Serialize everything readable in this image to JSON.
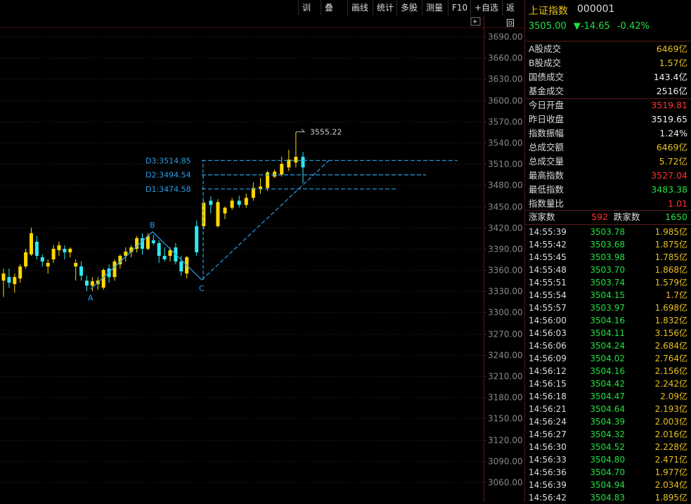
{
  "toolbar": {
    "buttons": [
      "训练",
      "叠加",
      "画线",
      "统计",
      "多股",
      "测量",
      "F10",
      "+自选",
      "返回"
    ]
  },
  "colors": {
    "up": "#ffd700",
    "down": "#30e8f0",
    "accent_cyan": "#2a9fe8",
    "green": "#22e040",
    "red": "#ff3030"
  },
  "quote": {
    "name": "上证指数",
    "code": "000001",
    "price": "3505.00",
    "arrow": "▼",
    "change": "-14.65",
    "change_pct": "-0.42%"
  },
  "stats": [
    {
      "label": "A股成交",
      "value": "6469亿",
      "color": "yellow"
    },
    {
      "label": "B股成交",
      "value": "1.57亿",
      "color": "yellow"
    },
    {
      "label": "国债成交",
      "value": "143.4亿",
      "color": "white"
    },
    {
      "label": "基金成交",
      "value": "2516亿",
      "color": "white"
    },
    {
      "label": "今日开盘",
      "value": "3519.81",
      "color": "red"
    },
    {
      "label": "昨日收盘",
      "value": "3519.65",
      "color": "white"
    },
    {
      "label": "指数振幅",
      "value": "1.24%",
      "color": "white"
    },
    {
      "label": "总成交额",
      "value": "6469亿",
      "color": "yellow"
    },
    {
      "label": "总成交量",
      "value": "5.72亿",
      "color": "yellow"
    },
    {
      "label": "最高指数",
      "value": "3527.04",
      "color": "red"
    },
    {
      "label": "最低指数",
      "value": "3483.38",
      "color": "green"
    },
    {
      "label": "指数量比",
      "value": "1.01",
      "color": "red"
    }
  ],
  "breadth": {
    "up_label": "涨家数",
    "up_value": "592",
    "down_label": "跌家数",
    "down_value": "1650"
  },
  "ticks": [
    {
      "time": "14:55:39",
      "price": "3503.78",
      "vol": "1.985亿"
    },
    {
      "time": "14:55:42",
      "price": "3503.68",
      "vol": "1.875亿"
    },
    {
      "time": "14:55:45",
      "price": "3503.98",
      "vol": "1.785亿"
    },
    {
      "time": "14:55:48",
      "price": "3503.70",
      "vol": "1.868亿"
    },
    {
      "time": "14:55:51",
      "price": "3503.74",
      "vol": "1.579亿"
    },
    {
      "time": "14:55:54",
      "price": "3504.15",
      "vol": "1.7亿"
    },
    {
      "time": "14:55:57",
      "price": "3503.97",
      "vol": "1.698亿"
    },
    {
      "time": "14:56:00",
      "price": "3504.16",
      "vol": "1.832亿"
    },
    {
      "time": "14:56:03",
      "price": "3504.11",
      "vol": "3.156亿"
    },
    {
      "time": "14:56:06",
      "price": "3504.24",
      "vol": "2.684亿"
    },
    {
      "time": "14:56:09",
      "price": "3504.02",
      "vol": "2.764亿"
    },
    {
      "time": "14:56:12",
      "price": "3504.16",
      "vol": "2.156亿"
    },
    {
      "time": "14:56:15",
      "price": "3504.42",
      "vol": "2.242亿"
    },
    {
      "time": "14:56:18",
      "price": "3504.47",
      "vol": "2.09亿"
    },
    {
      "time": "14:56:21",
      "price": "3504.64",
      "vol": "2.193亿"
    },
    {
      "time": "14:56:24",
      "price": "3504.39",
      "vol": "2.003亿"
    },
    {
      "time": "14:56:27",
      "price": "3504.32",
      "vol": "2.016亿"
    },
    {
      "time": "14:56:30",
      "price": "3504.52",
      "vol": "2.228亿"
    },
    {
      "time": "14:56:33",
      "price": "3504.80",
      "vol": "2.471亿"
    },
    {
      "time": "14:56:36",
      "price": "3504.70",
      "vol": "1.977亿"
    },
    {
      "time": "14:56:39",
      "price": "3504.94",
      "vol": "2.034亿"
    },
    {
      "time": "14:56:42",
      "price": "3504.83",
      "vol": "1.895亿"
    }
  ],
  "chart_data": {
    "type": "candlestick",
    "y_ticks": [
      "3690.00",
      "3660.00",
      "3630.00",
      "3600.00",
      "3570.00",
      "3540.00",
      "3510.00",
      "3480.00",
      "3450.00",
      "3420.00",
      "3390.00",
      "3360.00",
      "3330.00",
      "3300.00",
      "3270.00",
      "3240.00",
      "3210.00",
      "3180.00",
      "3150.00",
      "3120.00",
      "3090.00",
      "3060.00"
    ],
    "ylim": [
      3048,
      3702
    ],
    "candles": [
      {
        "o": 3345,
        "h": 3362,
        "l": 3322,
        "c": 3355
      },
      {
        "o": 3350,
        "h": 3362,
        "l": 3335,
        "c": 3342
      },
      {
        "o": 3340,
        "h": 3355,
        "l": 3328,
        "c": 3350
      },
      {
        "o": 3348,
        "h": 3368,
        "l": 3342,
        "c": 3365
      },
      {
        "o": 3365,
        "h": 3390,
        "l": 3362,
        "c": 3385
      },
      {
        "o": 3382,
        "h": 3420,
        "l": 3380,
        "c": 3412
      },
      {
        "o": 3400,
        "h": 3408,
        "l": 3375,
        "c": 3380
      },
      {
        "o": 3378,
        "h": 3382,
        "l": 3365,
        "c": 3372
      },
      {
        "o": 3365,
        "h": 3375,
        "l": 3355,
        "c": 3370
      },
      {
        "o": 3375,
        "h": 3395,
        "l": 3370,
        "c": 3390
      },
      {
        "o": 3388,
        "h": 3400,
        "l": 3380,
        "c": 3395
      },
      {
        "o": 3390,
        "h": 3395,
        "l": 3375,
        "c": 3385
      },
      {
        "o": 3385,
        "h": 3392,
        "l": 3378,
        "c": 3390
      },
      {
        "o": 3365,
        "h": 3375,
        "l": 3345,
        "c": 3370
      },
      {
        "o": 3365,
        "h": 3372,
        "l": 3345,
        "c": 3352
      },
      {
        "o": 3345,
        "h": 3352,
        "l": 3330,
        "c": 3338
      },
      {
        "o": 3338,
        "h": 3350,
        "l": 3330,
        "c": 3344
      },
      {
        "o": 3340,
        "h": 3350,
        "l": 3332,
        "c": 3345
      },
      {
        "o": 3335,
        "h": 3362,
        "l": 3332,
        "c": 3360
      },
      {
        "o": 3362,
        "h": 3368,
        "l": 3342,
        "c": 3350
      },
      {
        "o": 3350,
        "h": 3375,
        "l": 3345,
        "c": 3372
      },
      {
        "o": 3368,
        "h": 3382,
        "l": 3362,
        "c": 3380
      },
      {
        "o": 3380,
        "h": 3392,
        "l": 3372,
        "c": 3386
      },
      {
        "o": 3385,
        "h": 3395,
        "l": 3378,
        "c": 3392
      },
      {
        "o": 3390,
        "h": 3408,
        "l": 3385,
        "c": 3405
      },
      {
        "o": 3405,
        "h": 3412,
        "l": 3382,
        "c": 3390
      },
      {
        "o": 3390,
        "h": 3412,
        "l": 3388,
        "c": 3408
      },
      {
        "o": 3402,
        "h": 3410,
        "l": 3395,
        "c": 3398
      },
      {
        "o": 3398,
        "h": 3402,
        "l": 3370,
        "c": 3380
      },
      {
        "o": 3380,
        "h": 3392,
        "l": 3372,
        "c": 3375
      },
      {
        "o": 3380,
        "h": 3392,
        "l": 3372,
        "c": 3388
      },
      {
        "o": 3392,
        "h": 3398,
        "l": 3368,
        "c": 3372
      },
      {
        "o": 3372,
        "h": 3380,
        "l": 3352,
        "c": 3358
      },
      {
        "o": 3355,
        "h": 3380,
        "l": 3348,
        "c": 3378
      },
      {
        "o": 3422,
        "h": 3430,
        "l": 3380,
        "c": 3385
      },
      {
        "o": 3422,
        "h": 3458,
        "l": 3418,
        "c": 3455
      },
      {
        "o": 3458,
        "h": 3464,
        "l": 3440,
        "c": 3452
      },
      {
        "o": 3422,
        "h": 3460,
        "l": 3420,
        "c": 3456
      },
      {
        "o": 3440,
        "h": 3450,
        "l": 3432,
        "c": 3448
      },
      {
        "o": 3448,
        "h": 3462,
        "l": 3445,
        "c": 3458
      },
      {
        "o": 3458,
        "h": 3465,
        "l": 3448,
        "c": 3452
      },
      {
        "o": 3452,
        "h": 3468,
        "l": 3448,
        "c": 3462
      },
      {
        "o": 3462,
        "h": 3484,
        "l": 3458,
        "c": 3476
      },
      {
        "o": 3474,
        "h": 3490,
        "l": 3468,
        "c": 3478
      },
      {
        "o": 3476,
        "h": 3500,
        "l": 3472,
        "c": 3498
      },
      {
        "o": 3492,
        "h": 3502,
        "l": 3490,
        "c": 3499
      },
      {
        "o": 3495,
        "h": 3520,
        "l": 3492,
        "c": 3510
      },
      {
        "o": 3505,
        "h": 3530,
        "l": 3500,
        "c": 3516
      },
      {
        "o": 3512,
        "h": 3555,
        "l": 3505,
        "c": 3520
      },
      {
        "o": 3520,
        "h": 3527,
        "l": 3483,
        "c": 3505
      }
    ],
    "annotations": {
      "points": [
        {
          "label": "A"
        },
        {
          "label": "B"
        },
        {
          "label": "C"
        }
      ],
      "levels": [
        {
          "label": "D3:3514.85",
          "value": 3514.85
        },
        {
          "label": "D2:3494.54",
          "value": 3494.54
        },
        {
          "label": "D1:3474.58",
          "value": 3474.58
        }
      ],
      "high_label": "3555.22"
    }
  }
}
